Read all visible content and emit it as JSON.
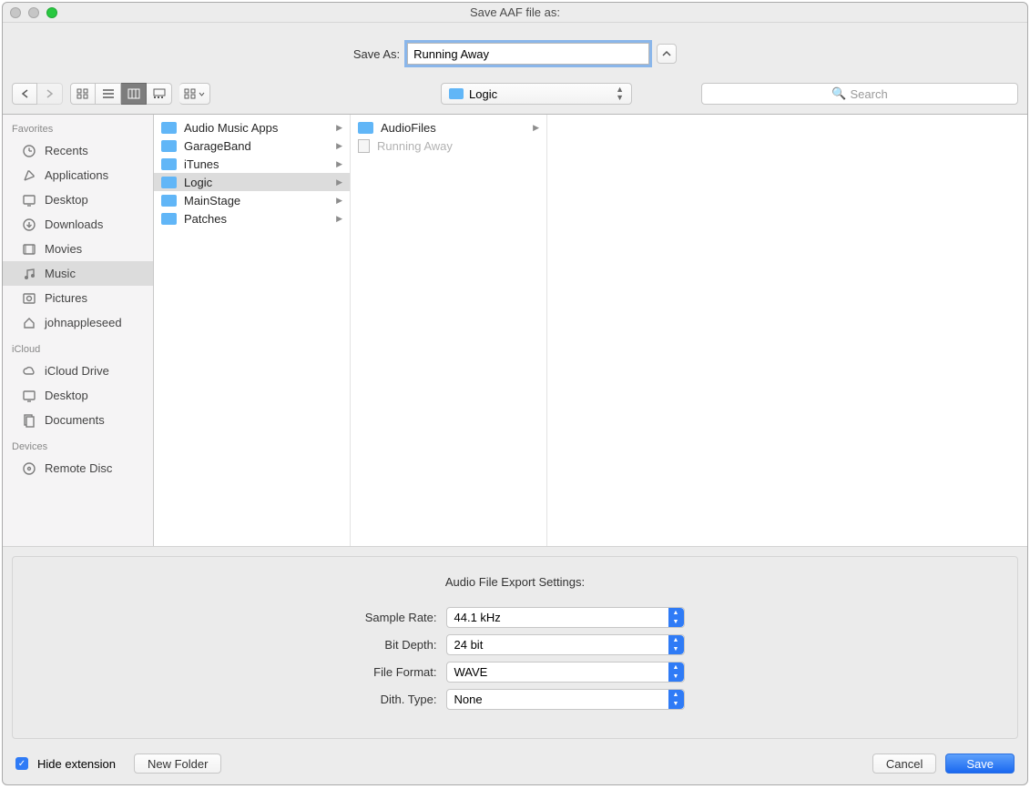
{
  "window": {
    "title": "Save AAF file as:"
  },
  "saveas": {
    "label": "Save As:",
    "value": "Running Away"
  },
  "path": {
    "folder": "Logic"
  },
  "search": {
    "placeholder": "Search"
  },
  "sidebar": {
    "sections": [
      {
        "header": "Favorites",
        "items": [
          {
            "icon": "clock",
            "label": "Recents"
          },
          {
            "icon": "apps",
            "label": "Applications"
          },
          {
            "icon": "desktop",
            "label": "Desktop"
          },
          {
            "icon": "downloads",
            "label": "Downloads"
          },
          {
            "icon": "movies",
            "label": "Movies"
          },
          {
            "icon": "music",
            "label": "Music",
            "selected": true
          },
          {
            "icon": "pictures",
            "label": "Pictures"
          },
          {
            "icon": "home",
            "label": "johnappleseed"
          }
        ]
      },
      {
        "header": "iCloud",
        "items": [
          {
            "icon": "cloud",
            "label": "iCloud Drive"
          },
          {
            "icon": "desktop",
            "label": "Desktop"
          },
          {
            "icon": "documents",
            "label": "Documents"
          }
        ]
      },
      {
        "header": "Devices",
        "items": [
          {
            "icon": "disc",
            "label": "Remote Disc"
          }
        ]
      }
    ]
  },
  "columns": [
    {
      "items": [
        {
          "label": "Audio Music Apps",
          "chev": true
        },
        {
          "label": "GarageBand",
          "chev": true
        },
        {
          "label": "iTunes",
          "chev": true
        },
        {
          "label": "Logic",
          "chev": true,
          "selected": true
        },
        {
          "label": "MainStage",
          "chev": true
        },
        {
          "label": "Patches",
          "chev": true
        }
      ]
    },
    {
      "items": [
        {
          "label": "AudioFiles",
          "chev": true
        },
        {
          "label": "Running Away",
          "dim": true,
          "file": true
        }
      ]
    }
  ],
  "settings": {
    "title": "Audio File Export Settings:",
    "rows": [
      {
        "label": "Sample Rate:",
        "value": "44.1 kHz"
      },
      {
        "label": "Bit Depth:",
        "value": "24 bit"
      },
      {
        "label": "File Format:",
        "value": "WAVE"
      },
      {
        "label": "Dith. Type:",
        "value": "None"
      }
    ]
  },
  "footer": {
    "hide_ext": "Hide extension",
    "new_folder": "New Folder",
    "cancel": "Cancel",
    "save": "Save"
  }
}
